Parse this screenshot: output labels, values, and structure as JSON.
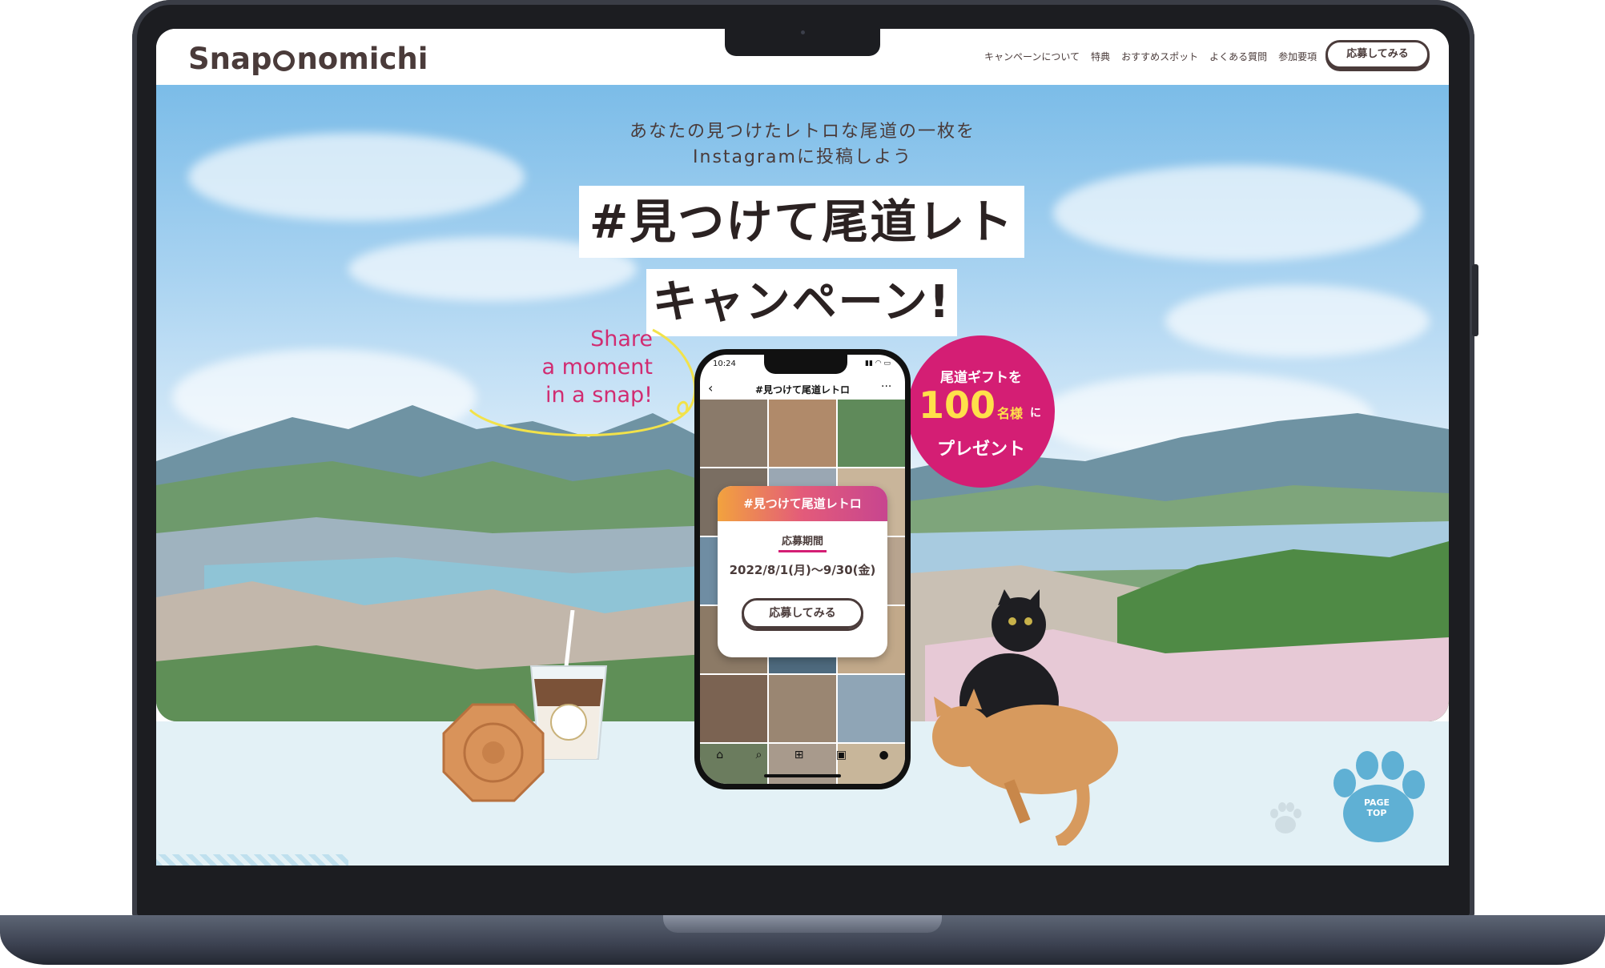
{
  "header": {
    "logo_left": "Snap",
    "logo_right": "nomichi",
    "nav": [
      "キャンペーンについて",
      "特典",
      "おすすめスポット",
      "よくある質問",
      "参加要項"
    ],
    "cta_label": "応募してみる"
  },
  "hero": {
    "subtitle_line1": "あなたの見つけたレトロな尾道の一枚を",
    "subtitle_line2": "Instagramに投稿しよう",
    "title_line1": "#見つけて尾道レトロ",
    "title_line2": "キャンペーン!",
    "share_line1": "Share",
    "share_line2": "a moment",
    "share_line3": "in a snap!"
  },
  "gift_badge": {
    "top": "尾道ギフトを",
    "number": "100",
    "unit": "名様",
    "particle": "に",
    "bottom": "プレゼント"
  },
  "phone": {
    "time": "10:24",
    "hashtag": "#見つけて尾道レトロ",
    "card": {
      "title": "#見つけて尾道レトロ",
      "period_label": "応募期間",
      "period": "2022/8/1(月)〜9/30(金)",
      "button": "応募してみる"
    },
    "tile_colors": [
      "#8a7a6a",
      "#b08a6a",
      "#5f8a5a",
      "#7a6e62",
      "#9aa7b3",
      "#c9b59a",
      "#6f8da3",
      "#a3b8c4",
      "#b8a48f",
      "#8c7a66",
      "#4e6a7e",
      "#c2a98a",
      "#7b6352",
      "#9a8672",
      "#8fa5b6",
      "#6b7c5e",
      "#a89a8c",
      "#c8b69a",
      "#5d7a8f",
      "#7d8a68",
      "#b79a7c"
    ],
    "nav_icons": [
      "home-icon",
      "search-icon",
      "plus-icon",
      "reels-icon",
      "profile-icon"
    ]
  },
  "page_top": {
    "line1": "PAGE",
    "line2": "TOP"
  },
  "colors": {
    "brand_brown": "#4a3b3a",
    "accent_pink": "#d41e74",
    "accent_yellow": "#ffe04a",
    "paw_blue": "#5fb0d4"
  }
}
